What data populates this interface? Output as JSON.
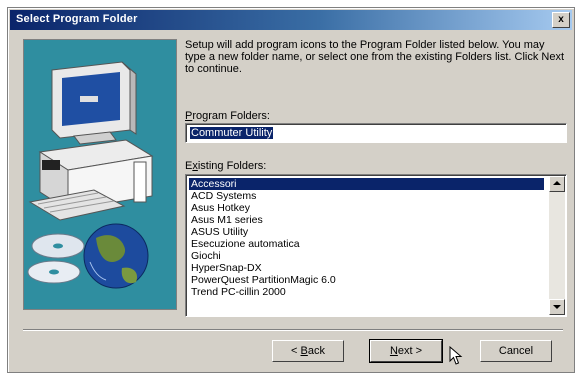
{
  "window": {
    "title": "Select Program Folder",
    "close_glyph": "x"
  },
  "description": "Setup will add program icons to the Program Folder listed below. You may type a new folder name, or select one from the existing Folders list. Click Next to continue.",
  "program_folder": {
    "label_u": "P",
    "label_rest": "rogram Folders:",
    "value": "Commuter Utility"
  },
  "existing_folders": {
    "label_u": "x",
    "label_pre": "E",
    "label_rest": "isting Folders:",
    "items": [
      {
        "label": "Accessori",
        "selected": true
      },
      {
        "label": "ACD Systems",
        "selected": false
      },
      {
        "label": "Asus Hotkey",
        "selected": false
      },
      {
        "label": "Asus M1 series",
        "selected": false
      },
      {
        "label": "ASUS Utility",
        "selected": false
      },
      {
        "label": "Esecuzione automatica",
        "selected": false
      },
      {
        "label": "Giochi",
        "selected": false
      },
      {
        "label": "HyperSnap-DX",
        "selected": false
      },
      {
        "label": "PowerQuest PartitionMagic 6.0",
        "selected": false
      },
      {
        "label": "Trend PC-cillin 2000",
        "selected": false
      }
    ]
  },
  "buttons": {
    "back": {
      "pre": "< ",
      "u": "B",
      "rest": "ack"
    },
    "next": {
      "u": "N",
      "rest": "ext >"
    },
    "cancel": {
      "label": "Cancel"
    }
  },
  "icons": {
    "art": "computer-and-globe-illustration",
    "close": "close-icon",
    "scroll_up": "scroll-up-arrow-icon",
    "scroll_down": "scroll-down-arrow-icon",
    "cursor": "mouse-pointer-icon"
  },
  "colors": {
    "titlebar_start": "#0a246a",
    "titlebar_end": "#a6caf0",
    "dialog_face": "#d4d0c8",
    "selection": "#0a246a",
    "art_background": "#2f8ea0"
  }
}
